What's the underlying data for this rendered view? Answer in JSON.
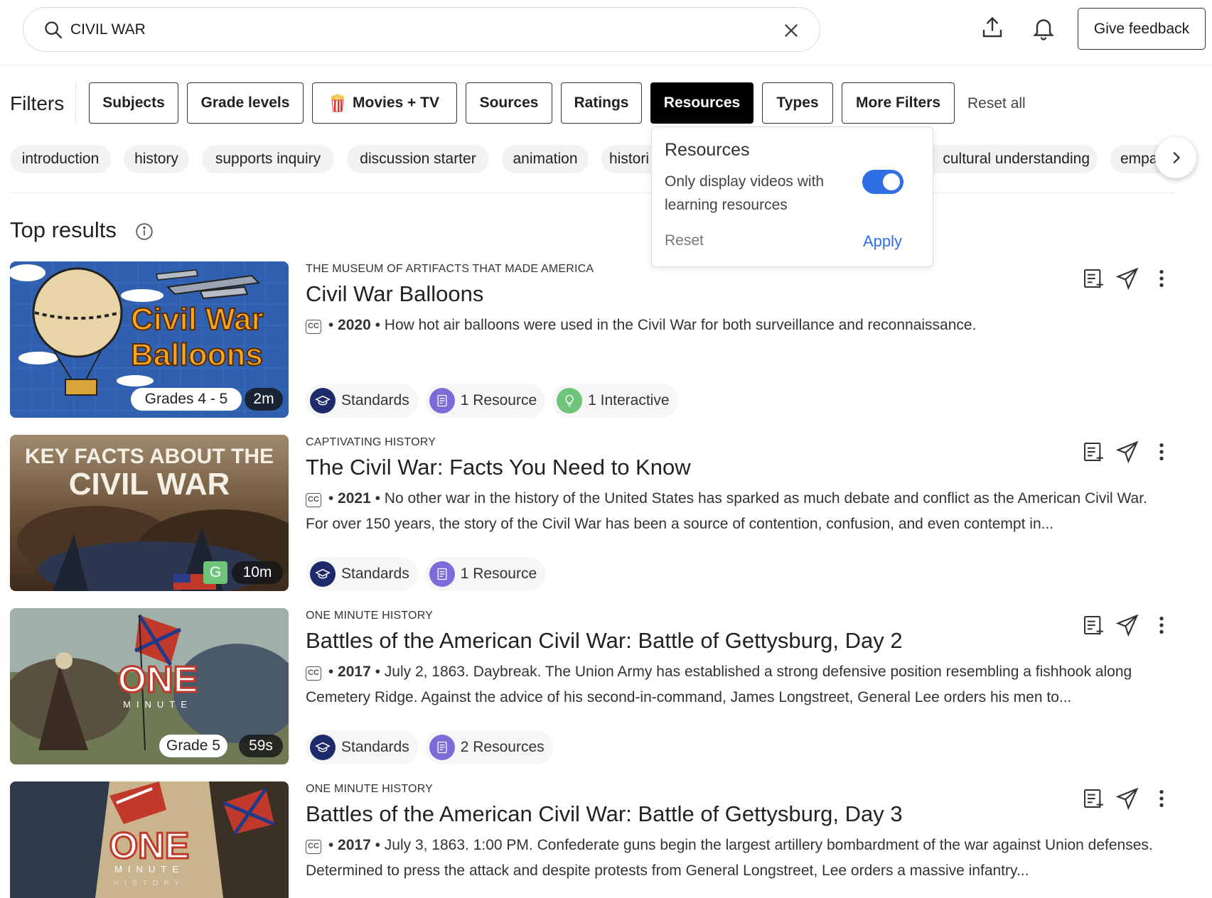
{
  "search": {
    "value": "CIVIL WAR"
  },
  "header": {
    "feedback_label": "Give feedback"
  },
  "filters": {
    "label": "Filters",
    "buttons": [
      "Subjects",
      "Grade levels",
      "Movies + TV",
      "Sources",
      "Ratings",
      "Resources",
      "Types",
      "More Filters"
    ],
    "active": "Resources",
    "reset_all": "Reset all"
  },
  "chips": [
    "introduction",
    "history",
    "supports inquiry",
    "discussion starter",
    "animation",
    "histori",
    "cultural understanding",
    "empa"
  ],
  "dropdown": {
    "title": "Resources",
    "description": "Only display videos with learning resources",
    "toggle_on": true,
    "reset": "Reset",
    "apply": "Apply"
  },
  "results_heading": "Top results",
  "results": [
    {
      "source": "THE MUSEUM OF ARTIFACTS THAT MADE AMERICA",
      "title": "Civil War Balloons",
      "year": "2020",
      "description": "How hot air balloons were used in the Civil War for both surveillance and reconnaissance.",
      "thumb_text": [
        "Civil War",
        "Balloons"
      ],
      "grade": "Grades 4 - 5",
      "duration": "2m",
      "tags": [
        {
          "icon": "standards-icon",
          "label": "Standards"
        },
        {
          "icon": "resource-icon",
          "label": "1 Resource"
        },
        {
          "icon": "interactive-icon",
          "label": "1 Interactive"
        }
      ]
    },
    {
      "source": "CAPTIVATING HISTORY",
      "title": "The Civil War: Facts You Need to Know",
      "year": "2021",
      "description": "No other war in the history of the United States has sparked as much debate and conflict as the American Civil War. For over 150 years, the story of the Civil War has been a source of contention, confusion, and even contempt in...",
      "thumb_text": [
        "KEY FACTS ABOUT THE",
        "CIVIL WAR"
      ],
      "rating": "G",
      "duration": "10m",
      "tags": [
        {
          "icon": "standards-icon",
          "label": "Standards"
        },
        {
          "icon": "resource-icon",
          "label": "1 Resource"
        }
      ]
    },
    {
      "source": "ONE MINUTE HISTORY",
      "title": "Battles of the American Civil War: Battle of Gettysburg, Day 2",
      "year": "2017",
      "description": "July 2, 1863. Daybreak. The Union Army has established a strong defensive position resembling a fishhook along Cemetery Ridge. Against the advice of his second-in-command, James Longstreet, General Lee orders his men to...",
      "thumb_text": [
        "ONE",
        "MINUTE"
      ],
      "grade": "Grade 5",
      "duration": "59s",
      "tags": [
        {
          "icon": "standards-icon",
          "label": "Standards"
        },
        {
          "icon": "resource-icon",
          "label": "2 Resources"
        }
      ]
    },
    {
      "source": "ONE MINUTE HISTORY",
      "title": "Battles of the American Civil War: Battle of Gettysburg, Day 3",
      "year": "2017",
      "description": "July 3, 1863. 1:00 PM. Confederate guns begin the largest artillery bombardment of the war against Union defenses. Determined to press the attack and despite protests from General Longstreet, Lee orders a massive infantry...",
      "thumb_text": [
        "ONE",
        "MINUTE",
        "HISTORY"
      ]
    }
  ],
  "colors": {
    "accent": "#2f6fe4",
    "resource": "#7d6bd9",
    "standards": "#1f2a6b",
    "interactive": "#6ec57a"
  }
}
